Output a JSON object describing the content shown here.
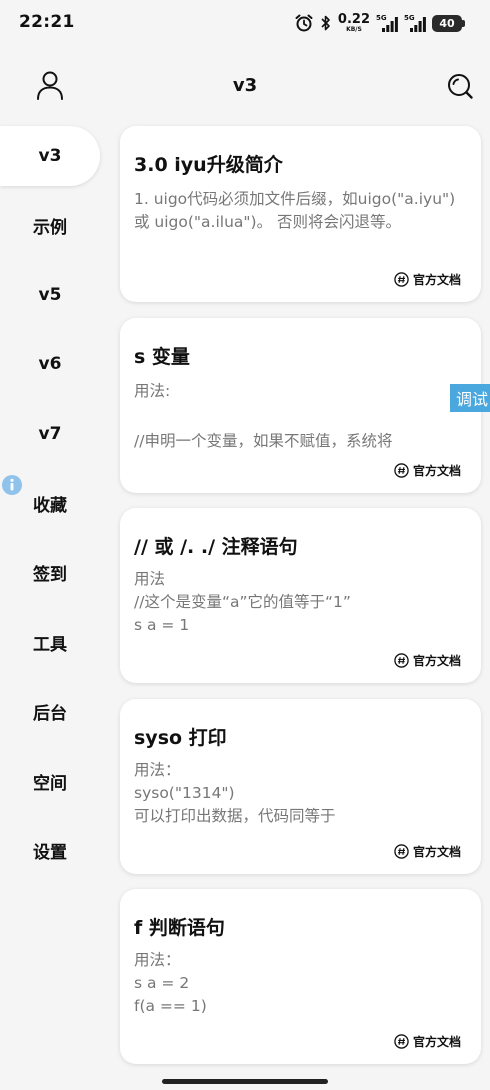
{
  "status_bar": {
    "time": "22:21",
    "speed_value": "0.22",
    "speed_unit": "KB/S",
    "sim1_tag": "5G",
    "sim2_tag": "5G",
    "battery": "40"
  },
  "header": {
    "title": "v3"
  },
  "sidebar": {
    "items": [
      {
        "label": "v3"
      },
      {
        "label": "示例"
      },
      {
        "label": "v5"
      },
      {
        "label": "v6"
      },
      {
        "label": "v7"
      },
      {
        "label": "收藏"
      },
      {
        "label": "签到"
      },
      {
        "label": "工具"
      },
      {
        "label": "后台"
      },
      {
        "label": "空间"
      },
      {
        "label": "设置"
      }
    ]
  },
  "cards": [
    {
      "title": "3.0 iyu升级简介",
      "body": "1. uigo代码必须加文件后缀，如uigo(\"a.iyu\") 或 uigo(\"a.ilua\")。 否则将会闪退等。",
      "link": "官方文档"
    },
    {
      "title": "s 变量",
      "lines": [
        "用法:",
        "",
        "//申明一个变量，如果不赋值，系统将"
      ],
      "link": "官方文档"
    },
    {
      "title": "// 或 /. ./ 注释语句",
      "lines": [
        "用法",
        "//这个是变量“a”它的值等于“1”",
        "s a = 1"
      ],
      "link": "官方文档"
    },
    {
      "title": "syso 打印",
      "lines": [
        "用法：",
        "syso(\"1314\")",
        "可以打印出数据，代码同等于"
      ],
      "link": "官方文档"
    },
    {
      "title": "f 判断语句",
      "lines": [
        "用法：",
        "s a = 2",
        "f(a == 1)"
      ],
      "link": "官方文档"
    }
  ],
  "debug_tab": "调试"
}
